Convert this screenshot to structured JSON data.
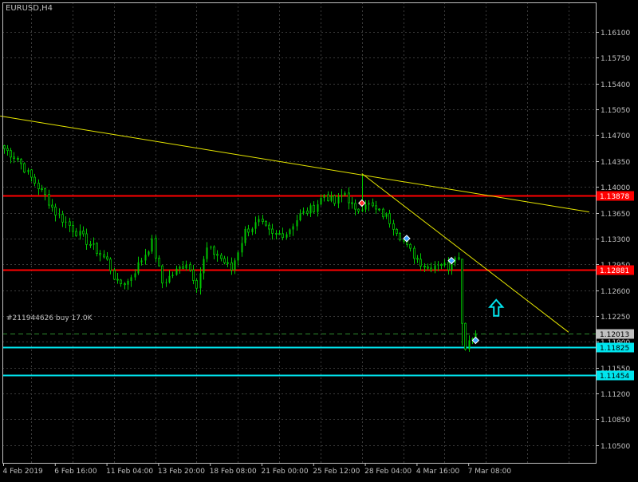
{
  "header": {
    "symbol_timeframe": "EURUSD,H4"
  },
  "order_label": "#211944626 buy 17.0K",
  "colors": {
    "background": "#000000",
    "grid": "#3a3a3a",
    "frame": "#c0c0c0",
    "text": "#c0c0c0",
    "bull": "#00c800",
    "bear": "#00c800",
    "resistance": "#ff0000",
    "support": "#00e5ee",
    "trendline": "#e6e600",
    "order_line": "#2d8b2d",
    "arrow": "#00e5ee",
    "marker_buy": "#3aa0ff",
    "marker_sell": "#ff3030"
  },
  "chart_data": {
    "type": "candlestick",
    "instrument": "EURUSD",
    "timeframe": "H4",
    "ylim": [
      1.1026,
      1.165
    ],
    "y_ticks": [
      "1.16100",
      "1.15750",
      "1.15400",
      "1.15050",
      "1.14700",
      "1.14350",
      "1.14000",
      "1.13650",
      "1.13300",
      "1.12950",
      "1.12600",
      "1.12250",
      "1.11900",
      "1.11550",
      "1.11200",
      "1.10850",
      "1.10500"
    ],
    "x_tick_labels": [
      "4 Feb 2019",
      "6 Feb 16:00",
      "11 Feb 04:00",
      "13 Feb 20:00",
      "18 Feb 08:00",
      "21 Feb 00:00",
      "25 Feb 12:00",
      "28 Feb 04:00",
      "4 Mar 16:00",
      "7 Mar 08:00"
    ],
    "x_tick_bars": [
      0,
      15,
      30,
      45,
      60,
      75,
      90,
      105,
      120,
      135
    ],
    "price_anchors": [
      [
        0,
        1.1452
      ],
      [
        4,
        1.1438
      ],
      [
        8,
        1.1412
      ],
      [
        12,
        1.1388
      ],
      [
        15,
        1.1365
      ],
      [
        18,
        1.1352
      ],
      [
        22,
        1.1335
      ],
      [
        26,
        1.1318
      ],
      [
        30,
        1.13
      ],
      [
        33,
        1.1268
      ],
      [
        36,
        1.1272
      ],
      [
        40,
        1.1302
      ],
      [
        43,
        1.1325
      ],
      [
        46,
        1.127
      ],
      [
        49,
        1.1282
      ],
      [
        53,
        1.1298
      ],
      [
        56,
        1.1268
      ],
      [
        59,
        1.1316
      ],
      [
        62,
        1.1308
      ],
      [
        66,
        1.1288
      ],
      [
        70,
        1.134
      ],
      [
        74,
        1.1352
      ],
      [
        78,
        1.1334
      ],
      [
        82,
        1.1338
      ],
      [
        86,
        1.1362
      ],
      [
        90,
        1.1372
      ],
      [
        93,
        1.139
      ],
      [
        96,
        1.1378
      ],
      [
        99,
        1.1392
      ],
      [
        102,
        1.1365
      ],
      [
        105,
        1.138
      ],
      [
        108,
        1.1368
      ],
      [
        111,
        1.136
      ],
      [
        114,
        1.1342
      ],
      [
        117,
        1.1318
      ],
      [
        120,
        1.1302
      ],
      [
        123,
        1.129
      ],
      [
        126,
        1.1298
      ],
      [
        129,
        1.1292
      ],
      [
        131,
        1.131
      ],
      [
        133,
        1.119
      ],
      [
        135,
        1.1188
      ],
      [
        137,
        1.1202
      ]
    ],
    "bar_count": 138,
    "horizontal_levels": [
      {
        "value": 1.13878,
        "label": "1.13878",
        "kind": "resistance"
      },
      {
        "value": 1.12881,
        "label": "1.12881",
        "kind": "resistance"
      },
      {
        "value": 1.11825,
        "label": "1.11825",
        "kind": "support"
      },
      {
        "value": 1.11454,
        "label": "1.11454",
        "kind": "support"
      }
    ],
    "current_price": {
      "value": 1.12013,
      "label": "1.12013"
    },
    "order_level": {
      "value": 1.12013
    },
    "trendlines": [
      {
        "from": [
          -1,
          1.1496
        ],
        "to": [
          170,
          1.1366
        ]
      },
      {
        "from": [
          104,
          1.1418
        ],
        "to": [
          164,
          1.1203
        ]
      }
    ],
    "signal_markers": [
      {
        "bar": 104,
        "price": 1.1378,
        "type": "sell"
      },
      {
        "bar": 117,
        "price": 1.133,
        "type": "buy"
      },
      {
        "bar": 130,
        "price": 1.13,
        "type": "buy"
      },
      {
        "bar": 137,
        "price": 1.1192,
        "type": "buy"
      }
    ],
    "buy_arrow": {
      "bar": 143,
      "price": 1.1235
    },
    "grid": true
  }
}
